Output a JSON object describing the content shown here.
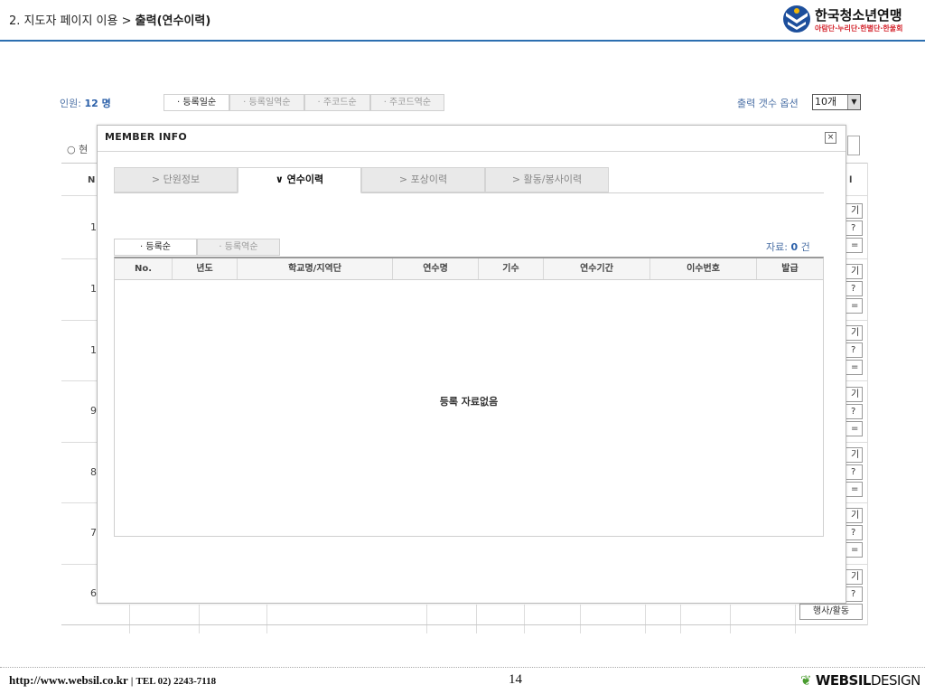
{
  "header": {
    "breadcrumb_prefix": "2. 지도자 페이지 이용 >",
    "breadcrumb_current": "출력(연수이력)",
    "logo_main": "한국청소년연맹",
    "logo_sub": "아람단·누리단·한별단·한울회",
    "accent_color": "#2c6fb0"
  },
  "background_page": {
    "count_label": "인원:",
    "count_value": "12 명",
    "sort_buttons": [
      "· 등록일순",
      "· 등록일역순",
      "· 주코드순",
      "· 주코드역순"
    ],
    "output_option_label": "출력 갯수 옵션",
    "output_option_value": "10개",
    "radio_label": "현",
    "column_head_no": "N",
    "column_head_last": "l",
    "row_numbers": [
      "1",
      "1",
      "1",
      "9",
      "8",
      "7",
      "6"
    ],
    "row_button_labels": [
      "기",
      "?",
      "="
    ],
    "event_button_label": "행사/활동"
  },
  "modal": {
    "title": "MEMBER INFO",
    "close_symbol": "×",
    "tabs": [
      {
        "label": "> 단원정보",
        "active": false
      },
      {
        "label": "∨ 연수이력",
        "active": true
      },
      {
        "label": "> 포상이력",
        "active": false
      },
      {
        "label": "> 활동/봉사이력",
        "active": false
      }
    ],
    "sub_sorts": [
      {
        "label": "· 등록순",
        "active": true
      },
      {
        "label": "· 등록역순",
        "active": false
      }
    ],
    "record_label": "자료:",
    "record_count": "0",
    "record_unit": "건",
    "columns": [
      "No.",
      "년도",
      "학교명/지역단",
      "연수명",
      "기수",
      "연수기간",
      "이수번호",
      "발급"
    ],
    "empty_message": "등록 자료없음"
  },
  "footer": {
    "url": "http://www.websil.co.kr",
    "separator": "|",
    "tel": "TEL 02) 2243-7118",
    "page_number": "14",
    "brand_bold": "WEBSIL",
    "brand_light": "DESIGN"
  }
}
